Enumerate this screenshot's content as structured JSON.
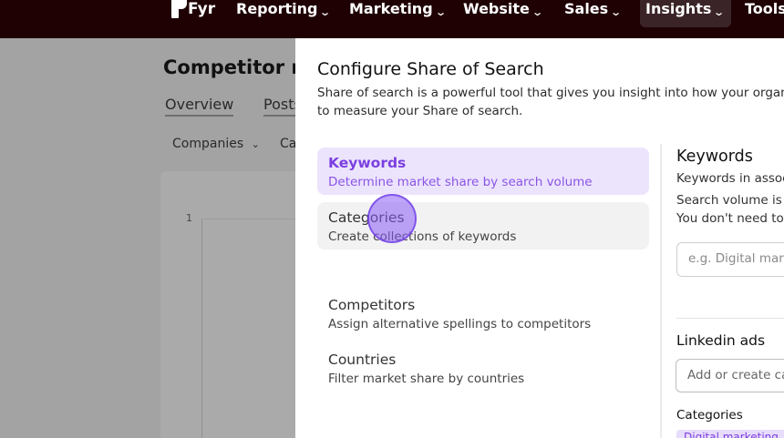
{
  "nav": {
    "logo_text": "Fyr",
    "items": [
      {
        "label": "Reporting",
        "active": false
      },
      {
        "label": "Marketing",
        "active": false
      },
      {
        "label": "Website",
        "active": false
      },
      {
        "label": "Sales",
        "active": false
      },
      {
        "label": "Insights",
        "active": true
      },
      {
        "label": "Tools",
        "active": false
      }
    ],
    "chevron_icon": "chevron-down-icon"
  },
  "background_page": {
    "title": "Competitor r",
    "tabs": [
      "Overview",
      "Posts"
    ],
    "filters": [
      "Companies",
      "Ca"
    ],
    "axis_tick": "1"
  },
  "drawer": {
    "title": "Configure Share of Search",
    "description_line1": "Share of search is a powerful tool that gives you insight into how your organiz",
    "description_line2": "to measure your Share of search.",
    "options": [
      {
        "title": "Keywords",
        "subtitle": "Determine market share by search volume",
        "state": "selected"
      },
      {
        "title": "Categories",
        "subtitle": "Create collections of keywords",
        "state": "hovered"
      },
      {
        "title": "Competitors",
        "subtitle": "Assign alternative spellings to competitors",
        "state": "default"
      },
      {
        "title": "Countries",
        "subtitle": "Filter market share by countries",
        "state": "default"
      }
    ],
    "right_panel": {
      "title": "Keywords",
      "line1": "Keywords in assoc",
      "line2": "Search volume is t",
      "line3": "You don't need to",
      "input_placeholder": "e.g. Digital mark",
      "section_title": "Linkedin ads",
      "section_input_placeholder": "Add or create ca",
      "categories_label": "Categories",
      "tag_text": "Digital marketing"
    }
  },
  "colors": {
    "nav_bg": "#1f0104",
    "accent": "#7b3fe0",
    "selected_bg": "#ece4fd"
  }
}
